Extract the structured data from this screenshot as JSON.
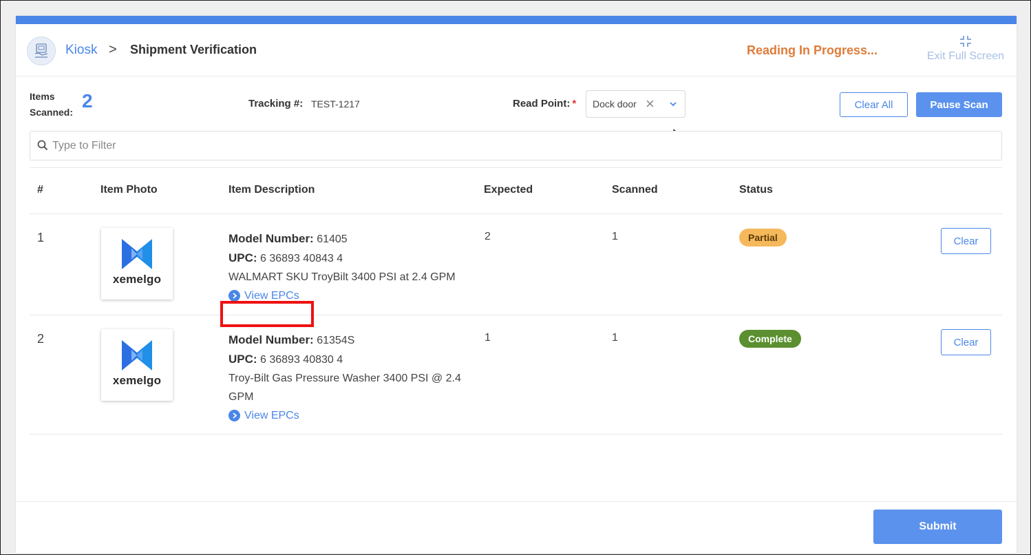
{
  "header": {
    "breadcrumb_root": "Kiosk",
    "breadcrumb_separator": ">",
    "breadcrumb_current": "Shipment Verification",
    "status": "Reading In Progress...",
    "exit_fullscreen": "Exit Full Screen"
  },
  "summary": {
    "items_label_line1": "Items",
    "items_label_line2": "Scanned:",
    "items_count": "2",
    "tracking_label": "Tracking #:",
    "tracking_value": "TEST-1217",
    "read_point_label": "Read Point:",
    "read_point_required": "*",
    "read_point_value": "Dock door"
  },
  "toolbar": {
    "clear_all": "Clear All",
    "pause_scan": "Pause Scan"
  },
  "filter": {
    "placeholder": "Type to Filter"
  },
  "table": {
    "headers": [
      "#",
      "Item Photo",
      "Item Description",
      "Expected",
      "Scanned",
      "Status"
    ],
    "rows": [
      {
        "index": "1",
        "photo_brand": "xemelgo",
        "model_label": "Model Number:",
        "model_value": "61405",
        "upc_label": "UPC:",
        "upc_value": "6 36893 40843 4",
        "description": "WALMART SKU TroyBilt 3400 PSI at 2.4 GPM",
        "view_epcs": "View EPCs",
        "expected": "2",
        "scanned": "1",
        "status": "Partial",
        "clear": "Clear"
      },
      {
        "index": "2",
        "photo_brand": "xemelgo",
        "model_label": "Model Number:",
        "model_value": "61354S",
        "upc_label": "UPC:",
        "upc_value": "6 36893 40830 4",
        "description": "Troy-Bilt Gas Pressure Washer 3400 PSI @ 2.4 GPM",
        "view_epcs": "View EPCs",
        "expected": "1",
        "scanned": "1",
        "status": "Complete",
        "clear": "Clear"
      }
    ]
  },
  "footer": {
    "submit": "Submit"
  },
  "colors": {
    "accent": "#4a86e8",
    "status_reading": "#e07b39",
    "badge_partial": "#f5b95c",
    "badge_complete": "#5b8f2f",
    "highlight": "#ee1111"
  }
}
